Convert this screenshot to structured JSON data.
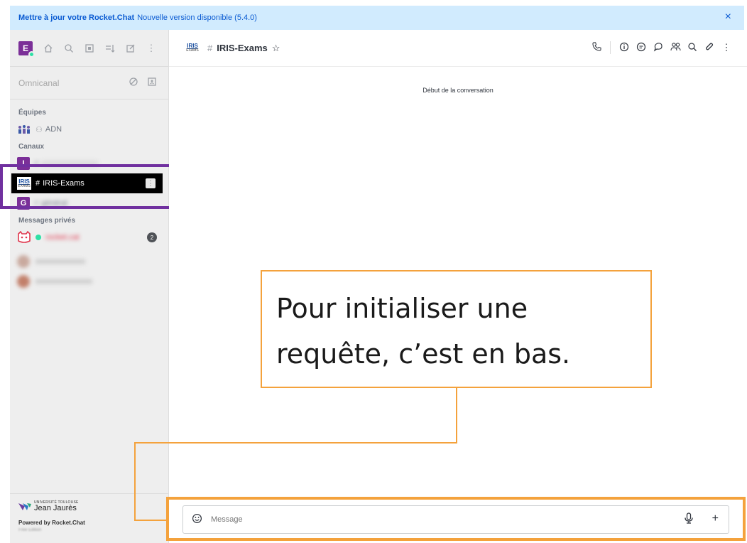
{
  "banner": {
    "title": "Mettre à jour votre Rocket.Chat",
    "message": "Nouvelle version disponible (5.4.0)",
    "close_icon": "×"
  },
  "sidebar": {
    "user_initial": "E",
    "top_icons": [
      "home-icon",
      "search-icon",
      "directory-icon",
      "sort-icon",
      "edit-icon",
      "kebab-icon"
    ],
    "search": {
      "label": "Omnicanal"
    },
    "sections": {
      "teams": "Équipes",
      "channels": "Canaux",
      "dms": "Messages privés"
    },
    "teams": [
      {
        "label": "ADN"
      }
    ],
    "channels": [
      {
        "initial": "I",
        "label": "",
        "blurred": true
      },
      {
        "label": "IRIS-Exams",
        "active": true
      },
      {
        "initial": "G",
        "label": "général",
        "blurred": true
      }
    ],
    "dms": [
      {
        "label": "rocket.cat",
        "badge": "2"
      }
    ],
    "footer": {
      "logo_small": "UNIVERSITÉ TOULOUSE",
      "logo_big": "Jean Jaurès",
      "powered": "Powered by Rocket.Chat",
      "version": "Free Edition"
    }
  },
  "main": {
    "room_logo_top": "IRIS",
    "room_logo_bottom": "EXAMS",
    "room_title": "IRIS-Exams",
    "star": "☆",
    "tools": [
      "phone-icon",
      "info-icon",
      "threads-icon",
      "discussion-icon",
      "members-icon",
      "search-icon",
      "attachment-icon",
      "kebab-icon"
    ],
    "start_text": "Début de la conversation",
    "composer": {
      "placeholder": "Message",
      "mic": "🎙",
      "plus": "+"
    }
  },
  "callout": {
    "line1": "Pour initialiser une",
    "line2": "requête, c’est en bas."
  },
  "accent": {
    "purple": "#70309f",
    "orange": "#f4a23c",
    "banner_bg": "#d1ebfe",
    "banner_text": "#095ad2"
  }
}
